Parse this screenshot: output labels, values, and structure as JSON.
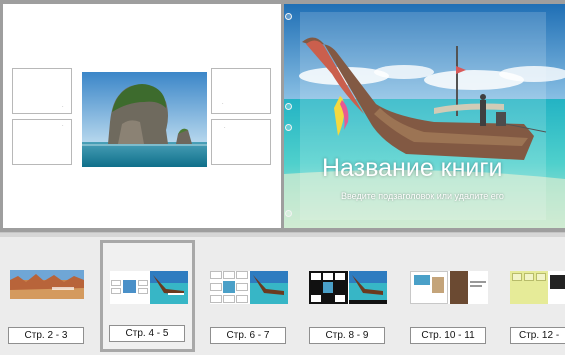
{
  "cover": {
    "title": "Название книги",
    "subtitle": "Введите подзаголовок или удалите его"
  },
  "thumbnails": [
    {
      "label": "Стр. 2 - 3",
      "selected": false
    },
    {
      "label": "Стр. 4 - 5",
      "selected": true
    },
    {
      "label": "Стр. 6 - 7",
      "selected": false
    },
    {
      "label": "Стр. 8 - 9",
      "selected": false
    },
    {
      "label": "Стр. 10 - 11",
      "selected": false
    },
    {
      "label": "Стр. 12 -",
      "selected": false
    }
  ],
  "colors": {
    "workspace": "#9e9e9e",
    "strip": "#ececec",
    "selection_border": "#a8a8a8"
  }
}
